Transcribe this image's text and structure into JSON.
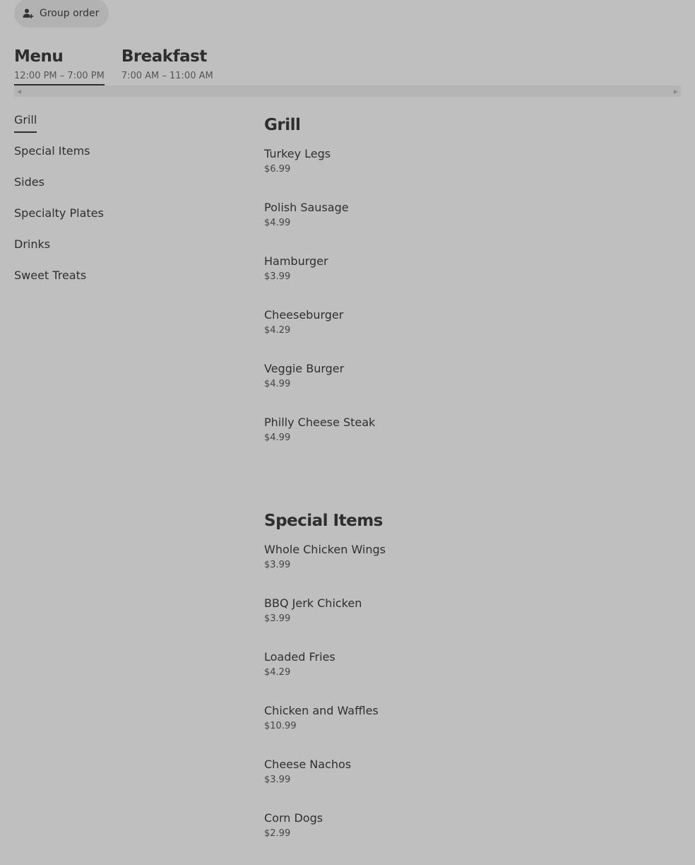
{
  "group_order": {
    "label": "Group order",
    "icon": "group-add-icon"
  },
  "tabs": [
    {
      "title": "Menu",
      "hours": "12:00 PM – 7:00 PM",
      "active": true
    },
    {
      "title": "Breakfast",
      "hours": "7:00 AM – 11:00 AM",
      "active": false
    }
  ],
  "sidenav": {
    "items": [
      {
        "label": "Grill",
        "active": true
      },
      {
        "label": "Special Items"
      },
      {
        "label": "Sides"
      },
      {
        "label": "Specialty Plates"
      },
      {
        "label": "Drinks"
      },
      {
        "label": "Sweet Treats"
      }
    ]
  },
  "sections": [
    {
      "title": "Grill",
      "items": [
        {
          "name": "Turkey Legs",
          "price": "$6.99"
        },
        {
          "name": "Polish Sausage",
          "price": "$4.99"
        },
        {
          "name": "Hamburger",
          "price": "$3.99"
        },
        {
          "name": "Cheeseburger",
          "price": "$4.29"
        },
        {
          "name": "Veggie Burger",
          "price": "$4.99"
        },
        {
          "name": "Philly Cheese Steak",
          "price": "$4.99"
        }
      ]
    },
    {
      "title": "Special Items",
      "items": [
        {
          "name": "Whole Chicken Wings",
          "price": "$3.99"
        },
        {
          "name": "BBQ Jerk Chicken",
          "price": "$3.99"
        },
        {
          "name": "Loaded Fries",
          "price": "$4.29"
        },
        {
          "name": "Chicken and Waffles",
          "price": "$10.99"
        },
        {
          "name": "Cheese Nachos",
          "price": "$3.99"
        },
        {
          "name": "Corn Dogs",
          "price": "$2.99"
        }
      ]
    }
  ]
}
